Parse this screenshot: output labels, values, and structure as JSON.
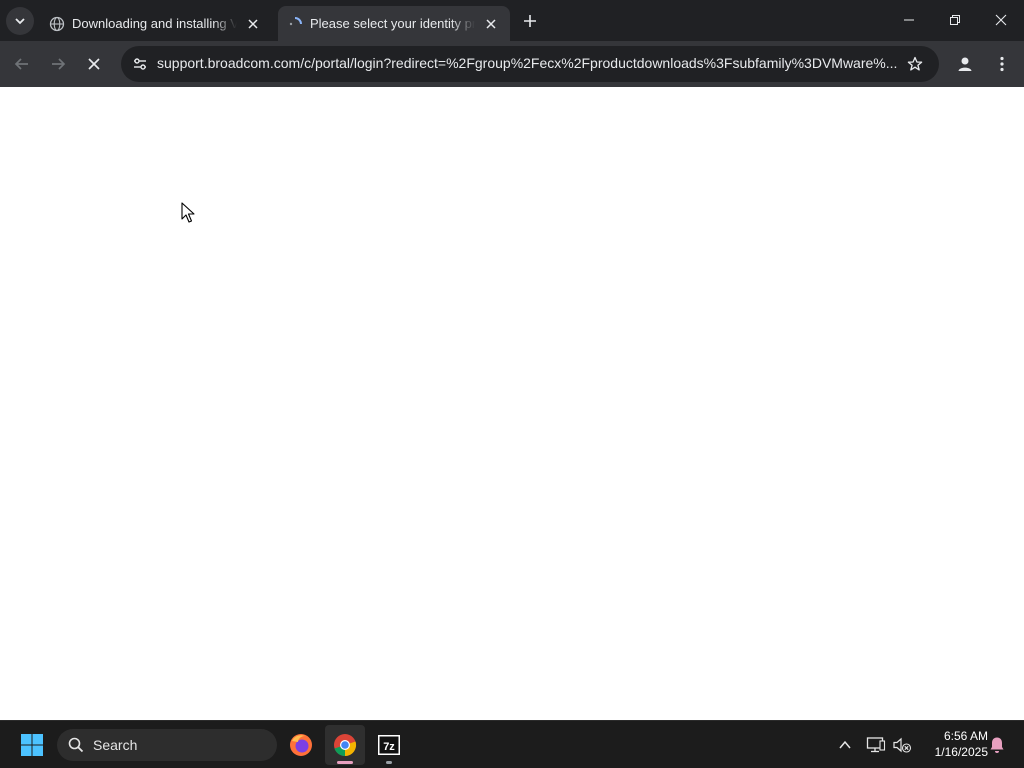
{
  "browser": {
    "tabs": [
      {
        "title": "Downloading and installing VMware",
        "favicon": "globe-icon",
        "active": false
      },
      {
        "title": "Please select your identity provider",
        "favicon": "loading-spinner-icon",
        "active": true
      }
    ],
    "url_domain": "support.broadcom.com",
    "url_path": "/c/portal/login?redirect=%2Fgroup%2Fecx%2Fproductdownloads%3Fsubfamily%3DVMware%..."
  },
  "taskbar": {
    "search_label": "Search",
    "apps": [
      "firefox-icon",
      "chrome-icon",
      "7zip-icon"
    ],
    "clock_time": "6:56 AM",
    "clock_date": "1/16/2025"
  },
  "colors": {
    "tabstrip_bg": "#202124",
    "toolbar_bg": "#35363a",
    "page_bg": "#ffffff",
    "taskbar_bg": "#1c1c1c",
    "chrome_indicator": "#e8a0c0"
  }
}
